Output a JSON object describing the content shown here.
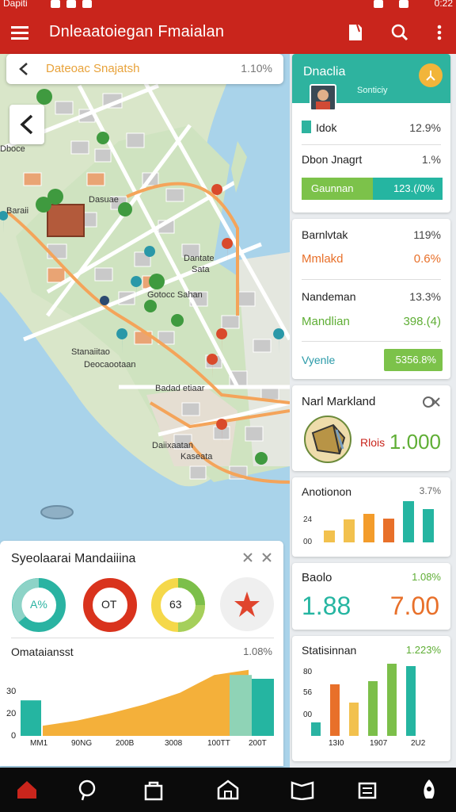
{
  "status_bar": {
    "left_text": "Dapiti",
    "right_text": "0:22"
  },
  "app_bar": {
    "title": "Dnleaatoiegan Fmaialan"
  },
  "map": {
    "search_text": "Dateoac Snajatsh",
    "search_percent": "1.10%",
    "labels": [
      "Dboce",
      "Baraii",
      "Dasuae",
      "Dantate",
      "Sata",
      "Gotocc Sahan",
      "Stanaiitao",
      "Deocaootaan",
      "Badad etiaar",
      "Daiixaatan",
      "Kaseata"
    ]
  },
  "panel_top": {
    "title": "Dnaclia",
    "subtitle": "Sonticiy",
    "row1_label": "Idok",
    "row1_value": "12.9%",
    "row2_label": "Dbon Jnagrt",
    "row2_value": "1.%",
    "bar_label": "Gaunnan",
    "bar_value": "123.(/0%"
  },
  "panel_stats": {
    "r1_label": "Barnlvtak",
    "r1_value": "119%",
    "r2_label": "Mmlakd",
    "r2_value": "0.6%",
    "r3_label": "Nandeman",
    "r3_value": "13.3%",
    "r4_label": "Mandlian",
    "r4_value": "398.(4)",
    "r5_label": "Vyenle",
    "r5_value": "5356.8%"
  },
  "panel_mark": {
    "title": "Narl Markland",
    "label": "Rlois",
    "value": "1.000"
  },
  "panel_anot": {
    "title": "Anotionon",
    "value": "3.7%",
    "y_labels": [
      "24",
      "00"
    ],
    "bars": [
      0.25,
      0.5,
      0.62,
      0.52,
      0.9,
      0.72
    ],
    "colors": [
      "#f2c14e",
      "#f2c14e",
      "#f39c2b",
      "#e8702a",
      "#25b5a1",
      "#25b5a1"
    ]
  },
  "panel_baolo": {
    "title": "Baolo",
    "value": "1.08%",
    "big_left": "1.88",
    "big_right": "7.00"
  },
  "panel_stat": {
    "title": "Statisinnan",
    "value": "1.223%",
    "y_labels": [
      "80",
      "56",
      "00"
    ],
    "x_labels": [
      "13I0",
      "1907",
      "2U2"
    ],
    "bars": [
      0.18,
      0.68,
      0.44,
      0.72,
      0.95,
      0.92
    ],
    "colors": [
      "#2ab3a2",
      "#e8702a",
      "#f2c14e",
      "#7cbf4a",
      "#7cbf4a",
      "#25b5a1"
    ]
  },
  "bottom_panel": {
    "title": "Syeolaarai Mandaiiina",
    "donuts": [
      {
        "label": "A%"
      },
      {
        "label": "OT"
      },
      {
        "label": "63"
      }
    ],
    "section_title": "Omataiansst",
    "section_value": "1.08%",
    "y_labels": [
      "30",
      "20",
      "0"
    ],
    "x_labels": [
      "MM1",
      "90NG",
      "200B",
      "3008",
      "100TT",
      "200T"
    ],
    "area_values": [
      8,
      12,
      18,
      25,
      34,
      48,
      52
    ],
    "bar_left_value": 28,
    "bar_right_value": 45
  },
  "colors": {
    "accent_red": "#c9251c",
    "teal": "#25b5a1",
    "green": "#7cbf4a",
    "orange": "#e8702a",
    "yellow": "#f2c14e"
  },
  "nav_icons": [
    "home-icon",
    "chat-icon",
    "bag-icon",
    "store-icon",
    "book-icon",
    "box-icon",
    "rocket-icon"
  ]
}
